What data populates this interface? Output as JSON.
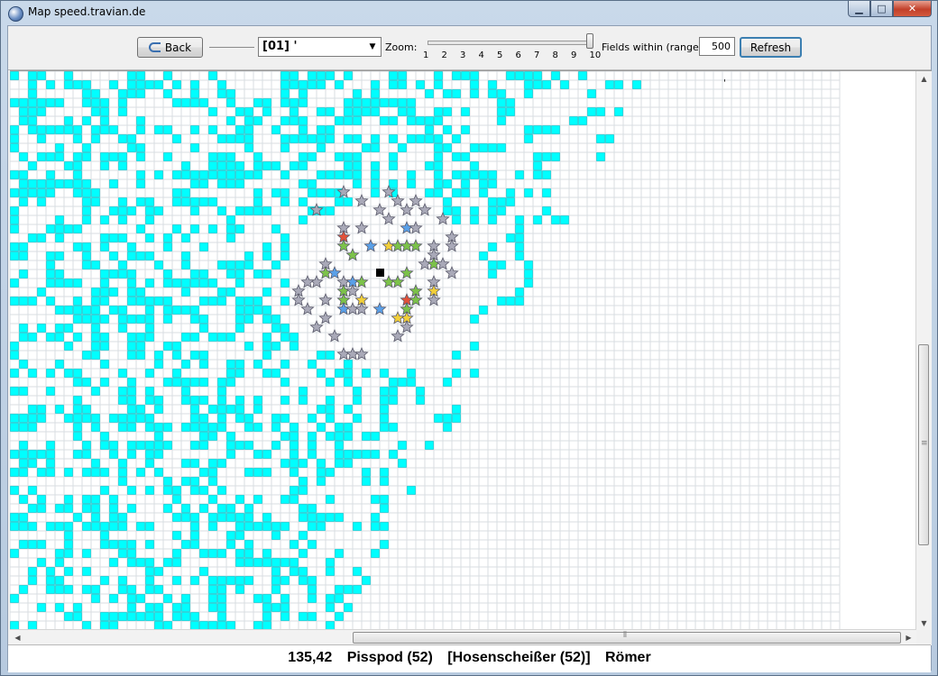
{
  "window": {
    "title": "Map speed.travian.de",
    "min_label": "▁",
    "max_label": "□",
    "close_label": "✕"
  },
  "toolbar": {
    "back_label": "Back",
    "village_select": "[01] '",
    "zoom_label": "Zoom:",
    "zoom_ticks": [
      "1",
      "2",
      "3",
      "4",
      "5",
      "6",
      "7",
      "8",
      "9",
      "10"
    ],
    "zoom_value": 10,
    "fields_label": "Fields within (range):",
    "range_value": "500",
    "refresh_label": "Refresh"
  },
  "map": {
    "tile_color": "#00ffff",
    "tile_border": "#00c8d0",
    "grid_color": "#d8dde2",
    "marker_color": "#000000",
    "star_colors": {
      "gray": "#a9a9b8",
      "green": "#7cc24a",
      "blue": "#5aa0e8",
      "yellow": "#f2cf3a",
      "red": "#e2523a"
    },
    "cursor_mark": "'"
  },
  "status": {
    "coords": "135,42",
    "player": "Pisspod (52)",
    "alliance": "[Hosenscheißer (52)]",
    "tribe": "Römer"
  }
}
